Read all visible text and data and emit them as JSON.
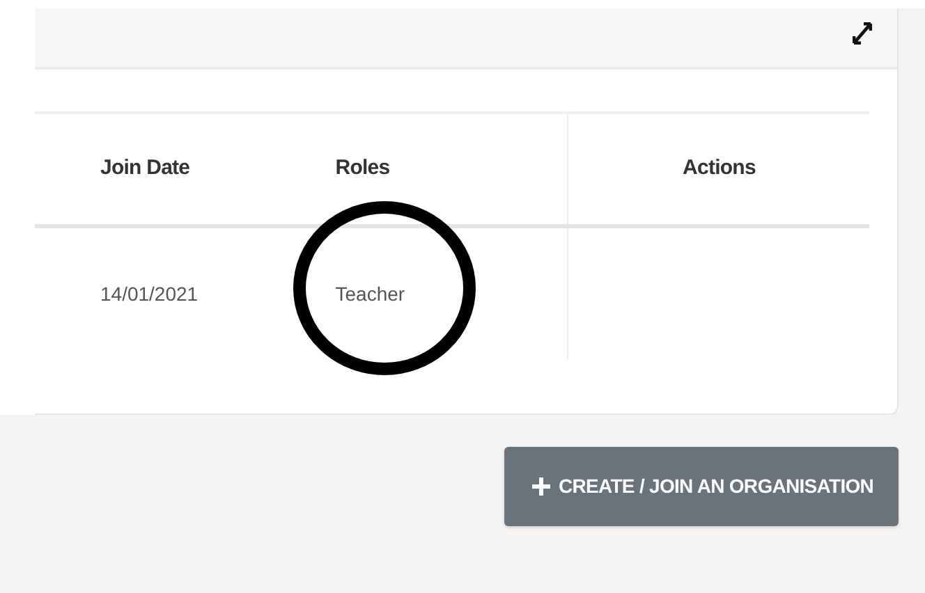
{
  "table": {
    "columns": [
      "Join Date",
      "Roles",
      "Actions"
    ],
    "rows": [
      {
        "cells": [
          {
            "text": "14/01/2021",
            "circled": false
          },
          {
            "text": "Teacher",
            "circled": true
          }
        ]
      }
    ]
  },
  "button": {
    "label": "CREATE / JOIN AN ORGANISATION"
  }
}
